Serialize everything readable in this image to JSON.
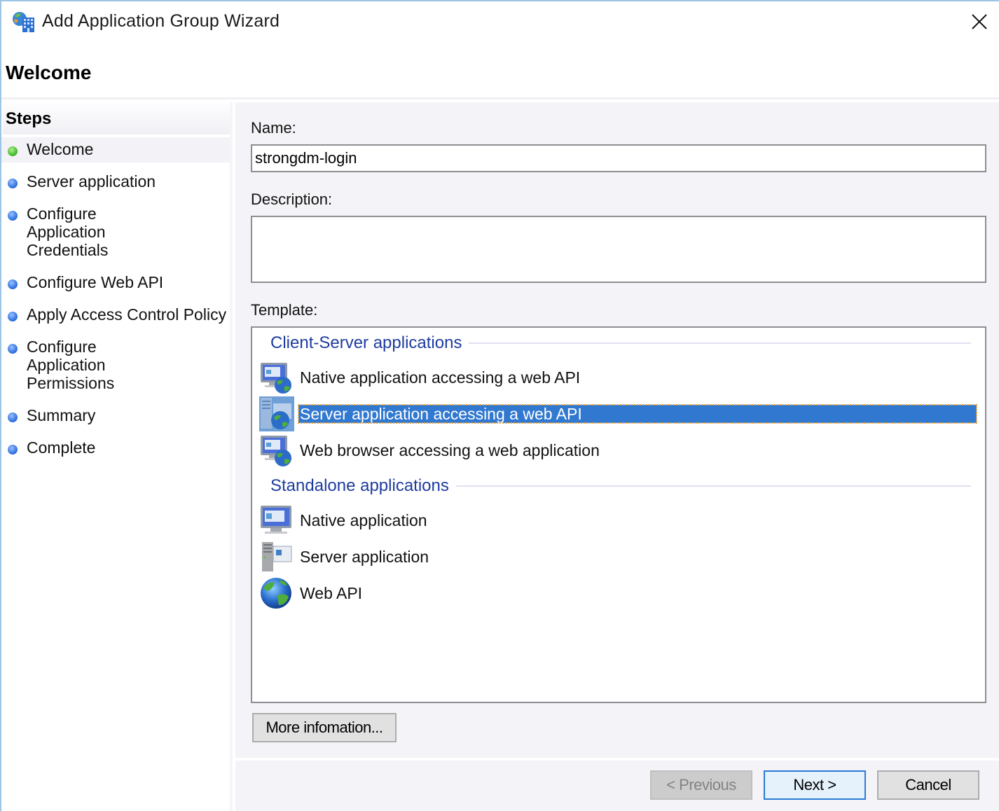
{
  "window": {
    "title": "Add Application Group Wizard",
    "icon": "application-group-icon",
    "close_icon": "close-icon"
  },
  "page": {
    "title": "Welcome"
  },
  "steps": {
    "header": "Steps",
    "items": [
      {
        "label": "Welcome",
        "status": "current",
        "dot_color": "#4fc23a"
      },
      {
        "label": "Server application",
        "status": "pending",
        "dot_color": "#3b7be6"
      },
      {
        "label": "Configure Application Credentials",
        "status": "pending",
        "dot_color": "#3b7be6"
      },
      {
        "label": "Configure Web API",
        "status": "pending",
        "dot_color": "#3b7be6"
      },
      {
        "label": "Apply Access Control Policy",
        "status": "pending",
        "dot_color": "#3b7be6"
      },
      {
        "label": "Configure Application Permissions",
        "status": "pending",
        "dot_color": "#3b7be6"
      },
      {
        "label": "Summary",
        "status": "pending",
        "dot_color": "#3b7be6"
      },
      {
        "label": "Complete",
        "status": "pending",
        "dot_color": "#3b7be6"
      }
    ]
  },
  "form": {
    "name_label": "Name:",
    "name_value": "strongdm-login",
    "description_label": "Description:",
    "description_value": "",
    "template_label": "Template:"
  },
  "templates": {
    "groups": [
      {
        "title": "Client-Server applications",
        "items": [
          {
            "label": "Native application accessing a web API",
            "icon": "native-app-web-api-icon",
            "selected": false
          },
          {
            "label": "Server application accessing a web API",
            "icon": "server-app-web-api-icon",
            "selected": true
          },
          {
            "label": "Web browser accessing a web application",
            "icon": "web-browser-web-app-icon",
            "selected": false
          }
        ]
      },
      {
        "title": "Standalone applications",
        "items": [
          {
            "label": "Native application",
            "icon": "native-app-icon",
            "selected": false
          },
          {
            "label": "Server application",
            "icon": "server-app-icon",
            "selected": false
          },
          {
            "label": "Web API",
            "icon": "globe-icon",
            "selected": false
          }
        ]
      }
    ],
    "selection_color": "#3178d0",
    "group_title_color": "#1e3c9e"
  },
  "buttons": {
    "more_info": "More infomation...",
    "previous": "< Previous",
    "next": "Next >",
    "cancel": "Cancel"
  }
}
